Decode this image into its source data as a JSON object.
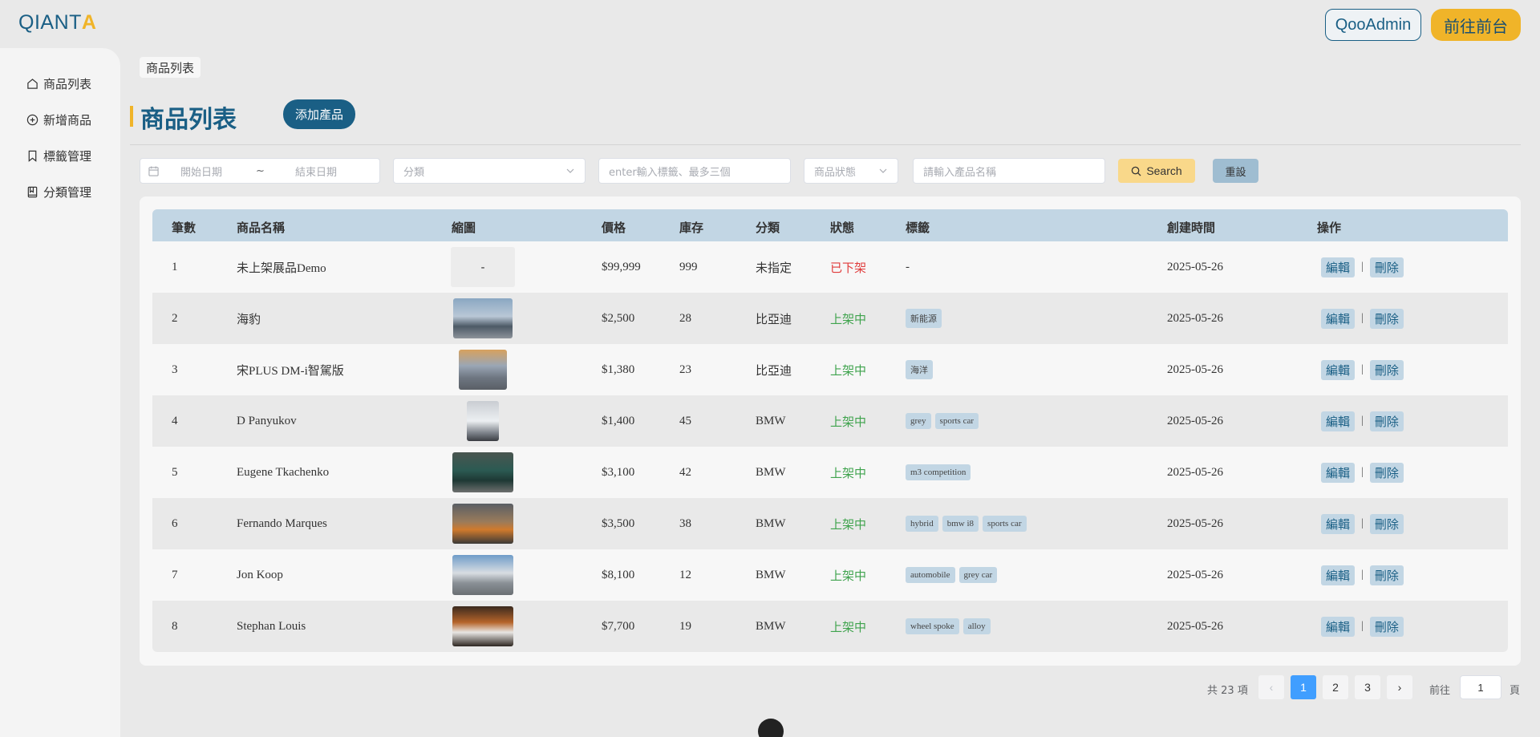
{
  "header": {
    "logo_main": "QIANT",
    "logo_accent": "A",
    "admin_button": "QooAdmin",
    "front_button": "前往前台"
  },
  "sidebar": {
    "items": [
      {
        "label": "商品列表",
        "icon": "home-icon"
      },
      {
        "label": "新增商品",
        "icon": "plus-circle-icon"
      },
      {
        "label": "標籤管理",
        "icon": "bookmark-icon"
      },
      {
        "label": "分類管理",
        "icon": "book-icon"
      }
    ]
  },
  "breadcrumb": "商品列表",
  "page": {
    "title": "商品列表",
    "add_button": "添加產品"
  },
  "filters": {
    "start_date": "開始日期",
    "date_sep": "~",
    "end_date": "結束日期",
    "category": "分類",
    "tags": "enter輸入標籤、最多三個",
    "status": "商品狀態",
    "name": "請輸入產品名稱",
    "search_button": "Search",
    "reset_button": "重設"
  },
  "table": {
    "headers": [
      "筆數",
      "商品名稱",
      "縮圖",
      "價格",
      "庫存",
      "分類",
      "狀態",
      "標籤",
      "創建時間",
      "操作"
    ],
    "edit_label": "編輯",
    "delete_label": "刪除",
    "separator": "|",
    "rows": [
      {
        "no": "1",
        "name": "未上架展品Demo",
        "thumb": "-",
        "price": "$99,999",
        "stock": "999",
        "category": "未指定",
        "status": "已下架",
        "status_color": "#e03b3b",
        "tags": [
          "-"
        ],
        "created": "2025-05-26"
      },
      {
        "no": "2",
        "name": "海豹",
        "thumb": "car-photo",
        "price": "$2,500",
        "stock": "28",
        "category": "比亞迪",
        "status": "上架中",
        "status_color": "#3fa34d",
        "tags": [
          "新能源"
        ],
        "created": "2025-05-26"
      },
      {
        "no": "3",
        "name": "宋PLUS DM-i智駕版",
        "thumb": "car-photo",
        "price": "$1,380",
        "stock": "23",
        "category": "比亞迪",
        "status": "上架中",
        "status_color": "#3fa34d",
        "tags": [
          "海洋"
        ],
        "created": "2025-05-26"
      },
      {
        "no": "4",
        "name": "D Panyukov",
        "thumb": "car-photo",
        "price": "$1,400",
        "stock": "45",
        "category": "BMW",
        "status": "上架中",
        "status_color": "#3fa34d",
        "tags": [
          "grey",
          "sports car"
        ],
        "created": "2025-05-26"
      },
      {
        "no": "5",
        "name": "Eugene Tkachenko",
        "thumb": "car-photo",
        "price": "$3,100",
        "stock": "42",
        "category": "BMW",
        "status": "上架中",
        "status_color": "#3fa34d",
        "tags": [
          "m3 competition"
        ],
        "created": "2025-05-26"
      },
      {
        "no": "6",
        "name": "Fernando Marques",
        "thumb": "car-photo",
        "price": "$3,500",
        "stock": "38",
        "category": "BMW",
        "status": "上架中",
        "status_color": "#3fa34d",
        "tags": [
          "hybrid",
          "bmw i8",
          "sports car"
        ],
        "created": "2025-05-26"
      },
      {
        "no": "7",
        "name": "Jon Koop",
        "thumb": "car-photo",
        "price": "$8,100",
        "stock": "12",
        "category": "BMW",
        "status": "上架中",
        "status_color": "#3fa34d",
        "tags": [
          "automobile",
          "grey car"
        ],
        "created": "2025-05-26"
      },
      {
        "no": "8",
        "name": "Stephan Louis",
        "thumb": "car-photo",
        "price": "$7,700",
        "stock": "19",
        "category": "BMW",
        "status": "上架中",
        "status_color": "#3fa34d",
        "tags": [
          "wheel spoke",
          "alloy"
        ],
        "created": "2025-05-26"
      }
    ]
  },
  "pagination": {
    "total": "共 23 項",
    "pages": [
      "1",
      "2",
      "3"
    ],
    "current": "1",
    "prev": "‹",
    "next": "›",
    "goto_label": "前往",
    "goto_value": "1",
    "page_suffix": "頁"
  },
  "colors": {
    "brand": "#1a5f85",
    "accent": "#f0b429",
    "header_row": "#c2d6e4",
    "active_page": "#409eff"
  }
}
